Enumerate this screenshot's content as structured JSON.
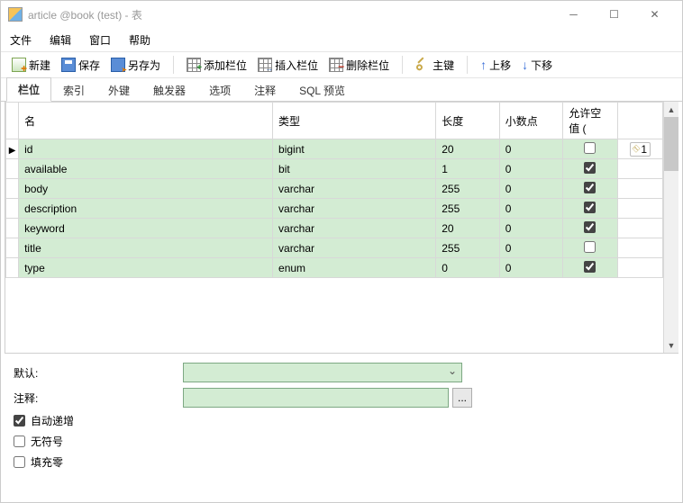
{
  "window": {
    "title": "article @book (test) - 表"
  },
  "menubar": {
    "file": "文件",
    "edit": "编辑",
    "window": "窗口",
    "help": "帮助"
  },
  "toolbar": {
    "new": "新建",
    "save": "保存",
    "saveas": "另存为",
    "addcol": "添加栏位",
    "inscol": "插入栏位",
    "delcol": "删除栏位",
    "pk": "主键",
    "up": "上移",
    "down": "下移"
  },
  "tabs": {
    "fields": "栏位",
    "indexes": "索引",
    "fk": "外键",
    "triggers": "触发器",
    "options": "选项",
    "comment": "注释",
    "preview": "SQL 预览"
  },
  "grid": {
    "headers": {
      "name": "名",
      "type": "类型",
      "length": "长度",
      "decimals": "小数点",
      "null": "允许空值 ("
    },
    "rows": [
      {
        "name": "id",
        "type": "bigint",
        "length": "20",
        "decimals": "0",
        "null": false,
        "key": 1
      },
      {
        "name": "available",
        "type": "bit",
        "length": "1",
        "decimals": "0",
        "null": true,
        "key": 0
      },
      {
        "name": "body",
        "type": "varchar",
        "length": "255",
        "decimals": "0",
        "null": true,
        "key": 0
      },
      {
        "name": "description",
        "type": "varchar",
        "length": "255",
        "decimals": "0",
        "null": true,
        "key": 0
      },
      {
        "name": "keyword",
        "type": "varchar",
        "length": "20",
        "decimals": "0",
        "null": true,
        "key": 0
      },
      {
        "name": "title",
        "type": "varchar",
        "length": "255",
        "decimals": "0",
        "null": false,
        "key": 0
      },
      {
        "name": "type",
        "type": "enum",
        "length": "0",
        "decimals": "0",
        "null": true,
        "key": 0
      }
    ],
    "keylabel": "1"
  },
  "bottom": {
    "default_label": "默认:",
    "default_value": "",
    "comment_label": "注释:",
    "comment_value": "",
    "autoinc": "自动递增",
    "autoinc_checked": true,
    "unsigned": "无符号",
    "unsigned_checked": false,
    "zerofill": "填充零",
    "zerofill_checked": false,
    "dots": "..."
  }
}
